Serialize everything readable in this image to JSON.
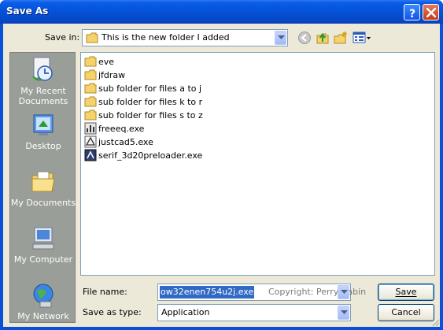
{
  "window": {
    "title": "Save As",
    "help_label": "?",
    "colors": {
      "titlebar": "#0452d6",
      "close": "#c43a18",
      "client": "#ece9d8",
      "selection": "#316ac5"
    }
  },
  "toolbar": {
    "save_in_label": "Save in:",
    "save_in_value": "This is the new folder I added",
    "icons": [
      "back-icon",
      "up-folder-icon",
      "new-folder-icon",
      "views-menu-icon"
    ]
  },
  "places": [
    {
      "label": "My Recent Documents",
      "icon": "recent-documents-icon"
    },
    {
      "label": "Desktop",
      "icon": "desktop-icon"
    },
    {
      "label": "My Documents",
      "icon": "my-documents-icon"
    },
    {
      "label": "My Computer",
      "icon": "my-computer-icon"
    },
    {
      "label": "My Network",
      "icon": "my-network-icon"
    }
  ],
  "files": [
    {
      "name": "eve",
      "type": "folder"
    },
    {
      "name": "jfdraw",
      "type": "folder"
    },
    {
      "name": "sub folder for files a to j",
      "type": "folder"
    },
    {
      "name": "sub folder for files k to r",
      "type": "folder"
    },
    {
      "name": "sub folder for files s to z",
      "type": "folder"
    },
    {
      "name": "freeeq.exe",
      "type": "exe"
    },
    {
      "name": "justcad5.exe",
      "type": "exe"
    },
    {
      "name": "serif_3d20preloader.exe",
      "type": "exe"
    }
  ],
  "form": {
    "filename_label": "File name:",
    "filename_value": "ow32enen754u2j.exe",
    "watermark": "Copyright: Perry Babin",
    "savetype_label": "Save as type:",
    "savetype_value": "Application",
    "save_button": "Save",
    "cancel_button": "Cancel"
  }
}
